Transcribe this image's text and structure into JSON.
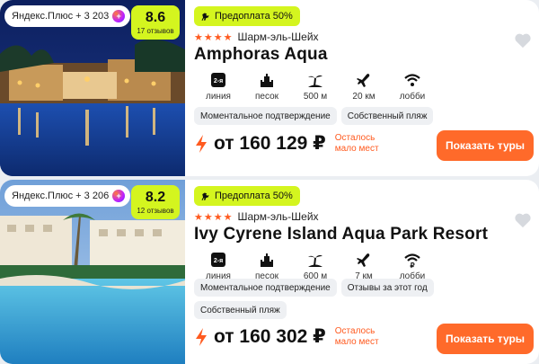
{
  "hotels": [
    {
      "plus_label": "Яндекс.Плюс + 3 203",
      "rating": "8.6",
      "reviews": "17 отзывов",
      "prepay": "Предоплата 50%",
      "stars": "★★★★",
      "location": "Шарм-эль-Шейх",
      "name": "Amphoras Aqua",
      "amenities": [
        {
          "icon": "line-badge-icon",
          "badge": "2-я",
          "label": "линия"
        },
        {
          "icon": "sand-castle-icon",
          "label": "песок"
        },
        {
          "icon": "beach-island-icon",
          "label": "500 м"
        },
        {
          "icon": "airplane-icon",
          "label": "20 км"
        },
        {
          "icon": "wifi-icon",
          "label": "лобби"
        }
      ],
      "tags": [
        "Моментальное подтверждение",
        "Собственный пляж"
      ],
      "price": "от 160 129 ₽",
      "left_note": "Осталось мало мест",
      "button": "Показать туры"
    },
    {
      "plus_label": "Яндекс.Плюс + 3 206",
      "rating": "8.2",
      "reviews": "12 отзывов",
      "prepay": "Предоплата 50%",
      "stars": "★★★★",
      "location": "Шарм-эль-Шейх",
      "name": "Ivy Cyrene Island Aqua Park Resort",
      "amenities": [
        {
          "icon": "line-badge-icon",
          "badge": "2-я",
          "label": "линия"
        },
        {
          "icon": "sand-castle-icon",
          "label": "песок"
        },
        {
          "icon": "beach-island-icon",
          "label": "600 м"
        },
        {
          "icon": "airplane-icon",
          "label": "7 км"
        },
        {
          "icon": "paid-wifi-icon",
          "label": "лобби"
        }
      ],
      "tags": [
        "Моментальное подтверждение",
        "Отзывы за этот год",
        "Собственный пляж"
      ],
      "price": "от 160 302 ₽",
      "left_note": "Осталось мало мест",
      "button": "Показать туры"
    }
  ],
  "colors": {
    "accent_lime": "#d4f51f",
    "accent_orange": "#ff6a2a",
    "star_orange": "#ff5a1f"
  }
}
